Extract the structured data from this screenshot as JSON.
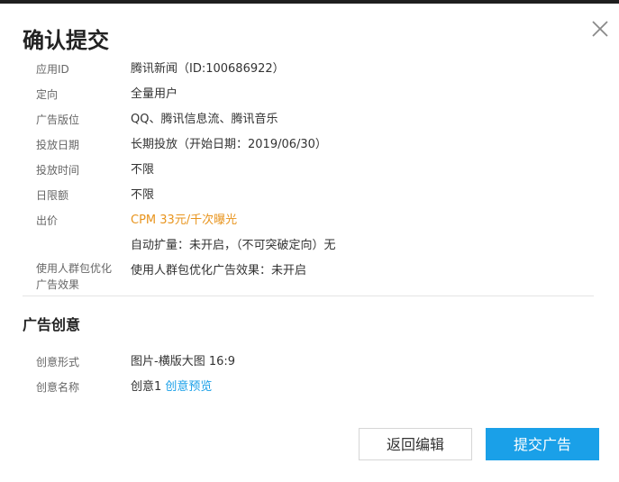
{
  "dialog": {
    "title": "确认提交",
    "close_icon": "close-icon"
  },
  "details": {
    "app_id": {
      "label": "应用ID",
      "value": "腾讯新闻（ID:100686922）"
    },
    "targeting": {
      "label": "定向",
      "value": "全量用户"
    },
    "placement": {
      "label": "广告版位",
      "value": "QQ、腾讯信息流、腾讯音乐"
    },
    "schedule": {
      "label": "投放日期",
      "value": "长期投放（开始日期：2019/06/30）"
    },
    "time": {
      "label": "投放时间",
      "value": "不限"
    },
    "daily_budget": {
      "label": "日限额",
      "value": "不限"
    },
    "bid": {
      "label": "出价",
      "value": "CPM 33元/千次曝光",
      "extra": "自动扩量：未开启，（不可突破定向）无",
      "value_color": "#e8941d"
    },
    "audience_opt": {
      "label": "使用人群包优化广告效果",
      "value": "使用人群包优化广告效果：未开启"
    }
  },
  "creative": {
    "section_title": "广告创意",
    "format": {
      "label": "创意形式",
      "value": "图片-横版大图 16:9"
    },
    "name": {
      "label": "创意名称",
      "value": "创意1",
      "preview_link": "创意预览"
    }
  },
  "buttons": {
    "back": "返回编辑",
    "submit": "提交广告"
  },
  "colors": {
    "accent": "#1aa0e8",
    "highlight": "#e8941d"
  }
}
